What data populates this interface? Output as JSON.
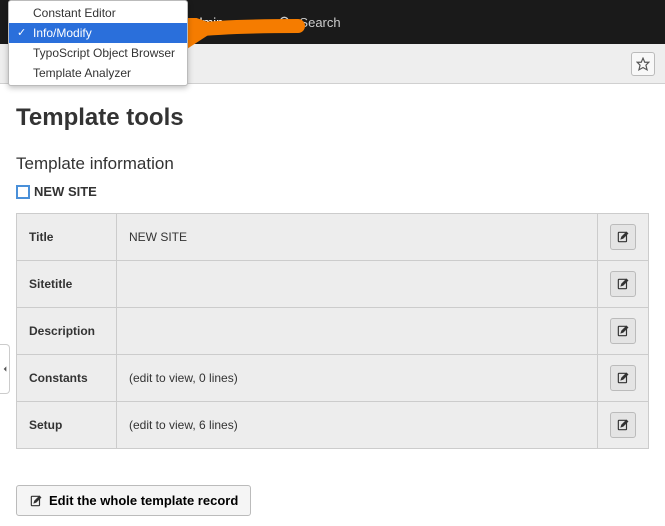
{
  "topbar": {
    "user_label": "admin",
    "search_label": "Search"
  },
  "dropdown": {
    "items": [
      {
        "label": "Constant Editor"
      },
      {
        "label": "Info/Modify",
        "selected": true
      },
      {
        "label": "TypoScript Object Browser"
      },
      {
        "label": "Template Analyzer"
      }
    ]
  },
  "page": {
    "title": "Template tools",
    "subtitle": "Template information",
    "site_name": "NEW SITE"
  },
  "rows": [
    {
      "label": "Title",
      "value": "NEW SITE"
    },
    {
      "label": "Sitetitle",
      "value": ""
    },
    {
      "label": "Description",
      "value": ""
    },
    {
      "label": "Constants",
      "value": "(edit to view, 0 lines)"
    },
    {
      "label": "Setup",
      "value": "(edit to view, 6 lines)"
    }
  ],
  "buttons": {
    "edit_whole": "Edit the whole template record"
  }
}
